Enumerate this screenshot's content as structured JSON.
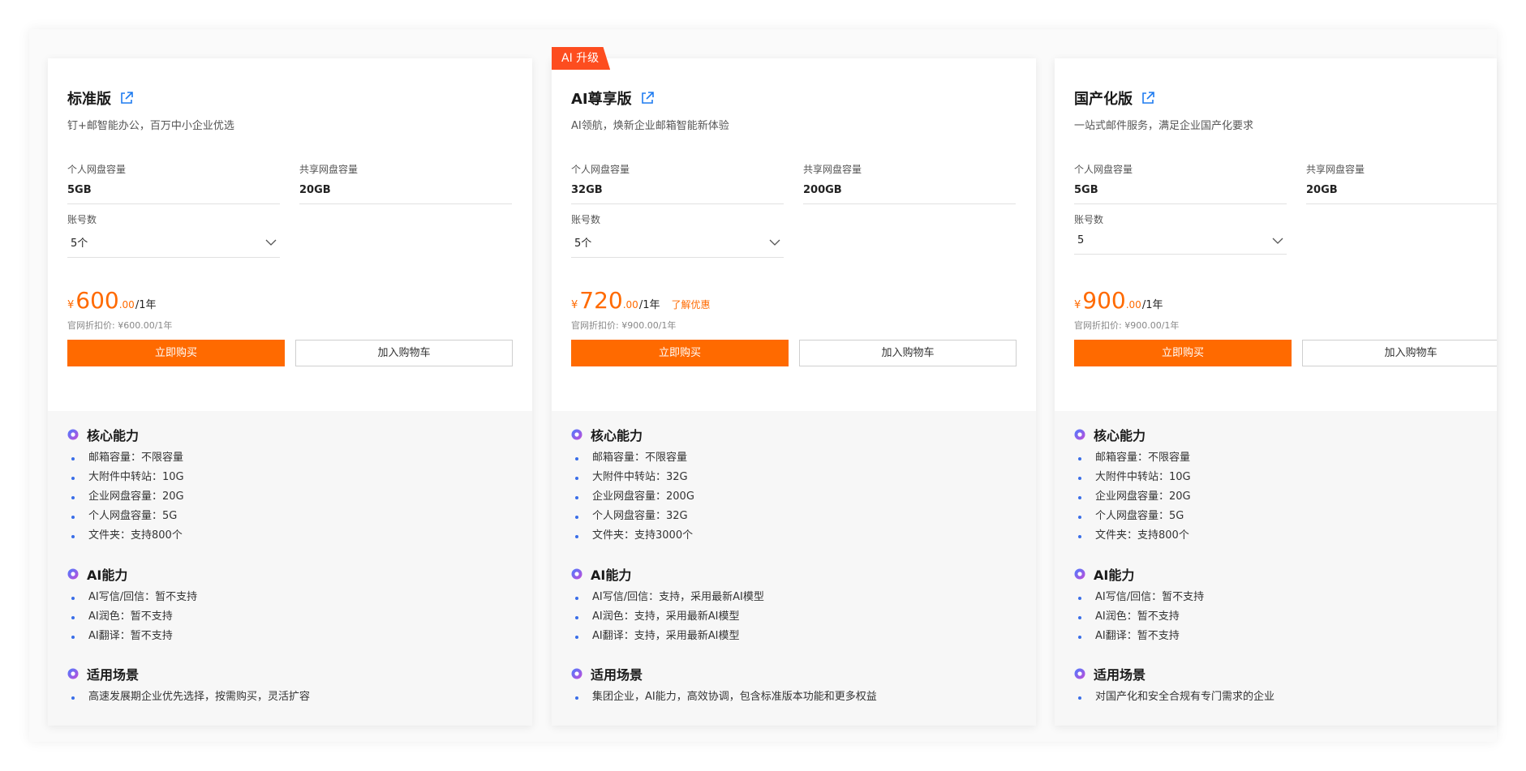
{
  "ribbon": "AI 升级",
  "colors": {
    "accent": "#ff6a00",
    "ribbon": "#fd4d1f",
    "bullet": "#3a6ee8"
  },
  "icons": {
    "title_link": "external-link-icon",
    "section": "gradient-badge-icon",
    "select": "chevron-down-icon"
  },
  "plans": [
    {
      "title": "标准版",
      "desc": "钉+邮智能办公，百万中小企业优选",
      "personal_label": "个人网盘容量",
      "personal_value": "5GB",
      "shared_label": "共享网盘容量",
      "shared_value": "20GB",
      "accounts_label": "账号数",
      "accounts_value": "5个",
      "currency": "¥",
      "price_int": "600",
      "price_dec": ".00",
      "period": "/1年",
      "promo": "",
      "original": "官网折扣价: ¥600.00/1年",
      "buy": "立即购买",
      "cart": "加入购物车",
      "core_title": "核心能力",
      "core": [
        "邮箱容量：不限容量",
        "大附件中转站：10G",
        "企业网盘容量：20G",
        "个人网盘容量：5G",
        "文件夹：支持800个"
      ],
      "ai_title": "AI能力",
      "ai": [
        "AI写信/回信：暂不支持",
        "AI润色：暂不支持",
        "AI翻译：暂不支持"
      ],
      "scene_title": "适用场景",
      "scene": [
        "高速发展期企业优先选择，按需购买，灵活扩容"
      ]
    },
    {
      "title": "AI尊享版",
      "desc": "AI领航，焕新企业邮箱智能新体验",
      "personal_label": "个人网盘容量",
      "personal_value": "32GB",
      "shared_label": "共享网盘容量",
      "shared_value": "200GB",
      "accounts_label": "账号数",
      "accounts_value": "5个",
      "currency": "¥",
      "price_int": "720",
      "price_dec": ".00",
      "period": "/1年",
      "promo": "了解优惠",
      "original": "官网折扣价: ¥900.00/1年",
      "buy": "立即购买",
      "cart": "加入购物车",
      "core_title": "核心能力",
      "core": [
        "邮箱容量：不限容量",
        "大附件中转站：32G",
        "企业网盘容量：200G",
        "个人网盘容量：32G",
        "文件夹：支持3000个"
      ],
      "ai_title": "AI能力",
      "ai": [
        "AI写信/回信：支持，采用最新AI模型",
        "AI润色：支持，采用最新AI模型",
        "AI翻译：支持，采用最新AI模型"
      ],
      "scene_title": "适用场景",
      "scene": [
        "集团企业，AI能力，高效协调，包含标准版本功能和更多权益"
      ]
    },
    {
      "title": "国产化版",
      "desc": "一站式邮件服务，满足企业国产化要求",
      "personal_label": "个人网盘容量",
      "personal_value": "5GB",
      "shared_label": "共享网盘容量",
      "shared_value": "20GB",
      "accounts_label": "账号数",
      "accounts_value": "5",
      "currency": "¥",
      "price_int": "900",
      "price_dec": ".00",
      "period": "/1年",
      "promo": "",
      "original": "官网折扣价: ¥900.00/1年",
      "buy": "立即购买",
      "cart": "加入购物车",
      "core_title": "核心能力",
      "core": [
        "邮箱容量：不限容量",
        "大附件中转站：10G",
        "企业网盘容量：20G",
        "个人网盘容量：5G",
        "文件夹：支持800个"
      ],
      "ai_title": "AI能力",
      "ai": [
        "AI写信/回信：暂不支持",
        "AI润色：暂不支持",
        "AI翻译：暂不支持"
      ],
      "scene_title": "适用场景",
      "scene": [
        "对国产化和安全合规有专门需求的企业"
      ]
    }
  ]
}
